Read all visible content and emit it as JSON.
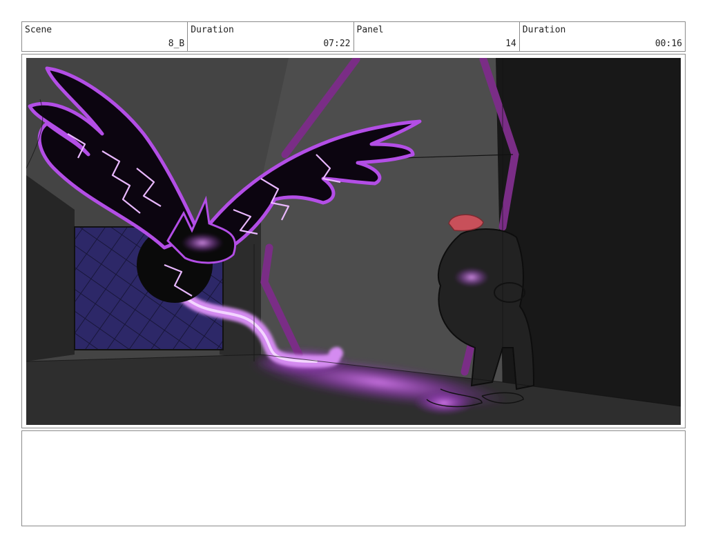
{
  "header": {
    "scene": {
      "label": "Scene",
      "value": "8_B"
    },
    "duration": {
      "label": "Duration",
      "value": "07:22"
    },
    "panel": {
      "label": "Panel",
      "value": "14"
    },
    "panel_duration": {
      "label": "Duration",
      "value": "00:16"
    }
  },
  "colors": {
    "glow": "#c04ee0",
    "pillar": "#7a2d86",
    "wall_dark": "#1a1a1a",
    "wall_mid": "#4a4a4a",
    "floor": "#2e2e2e",
    "grate": "#2e2870",
    "cap": "#c8505a"
  },
  "notes": {
    "text": ""
  }
}
